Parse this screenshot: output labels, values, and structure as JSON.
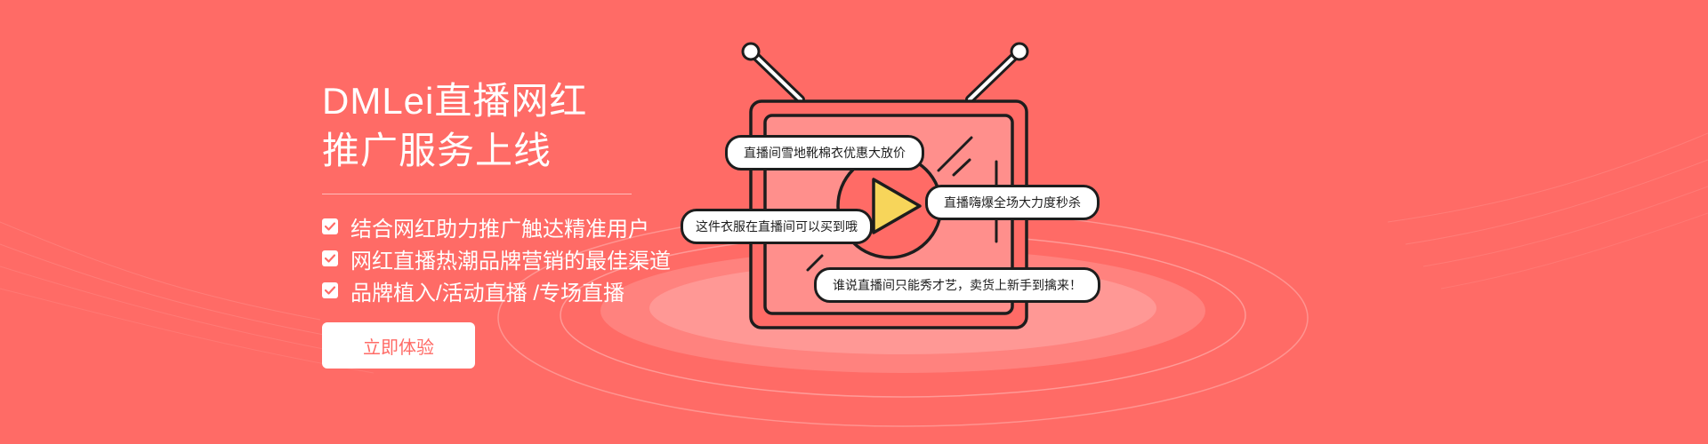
{
  "hero": {
    "title_line1": "DMLei直播网红",
    "title_line2": "推广服务上线",
    "features": [
      "结合网红助力推广触达精准用户",
      "网红直播热潮品牌营销的最佳渠道",
      "品牌植入/活动直播 /专场直播"
    ],
    "cta_label": "立即体验"
  },
  "bubbles": [
    "直播间雪地靴棉衣优惠大放价",
    "这件衣服在直播间可以买到哦",
    "直播嗨爆全场大力度秒杀",
    "谁说直播间只能秀才艺，卖货上新手到擒来！"
  ],
  "colors": {
    "background": "#ff6b66",
    "accent_text": "#ff6b66",
    "play_triangle": "#f7d55a",
    "outline": "#1d1d1d"
  },
  "icons": {
    "checkbox": "check-icon",
    "illustration": "tv-play-icon"
  }
}
